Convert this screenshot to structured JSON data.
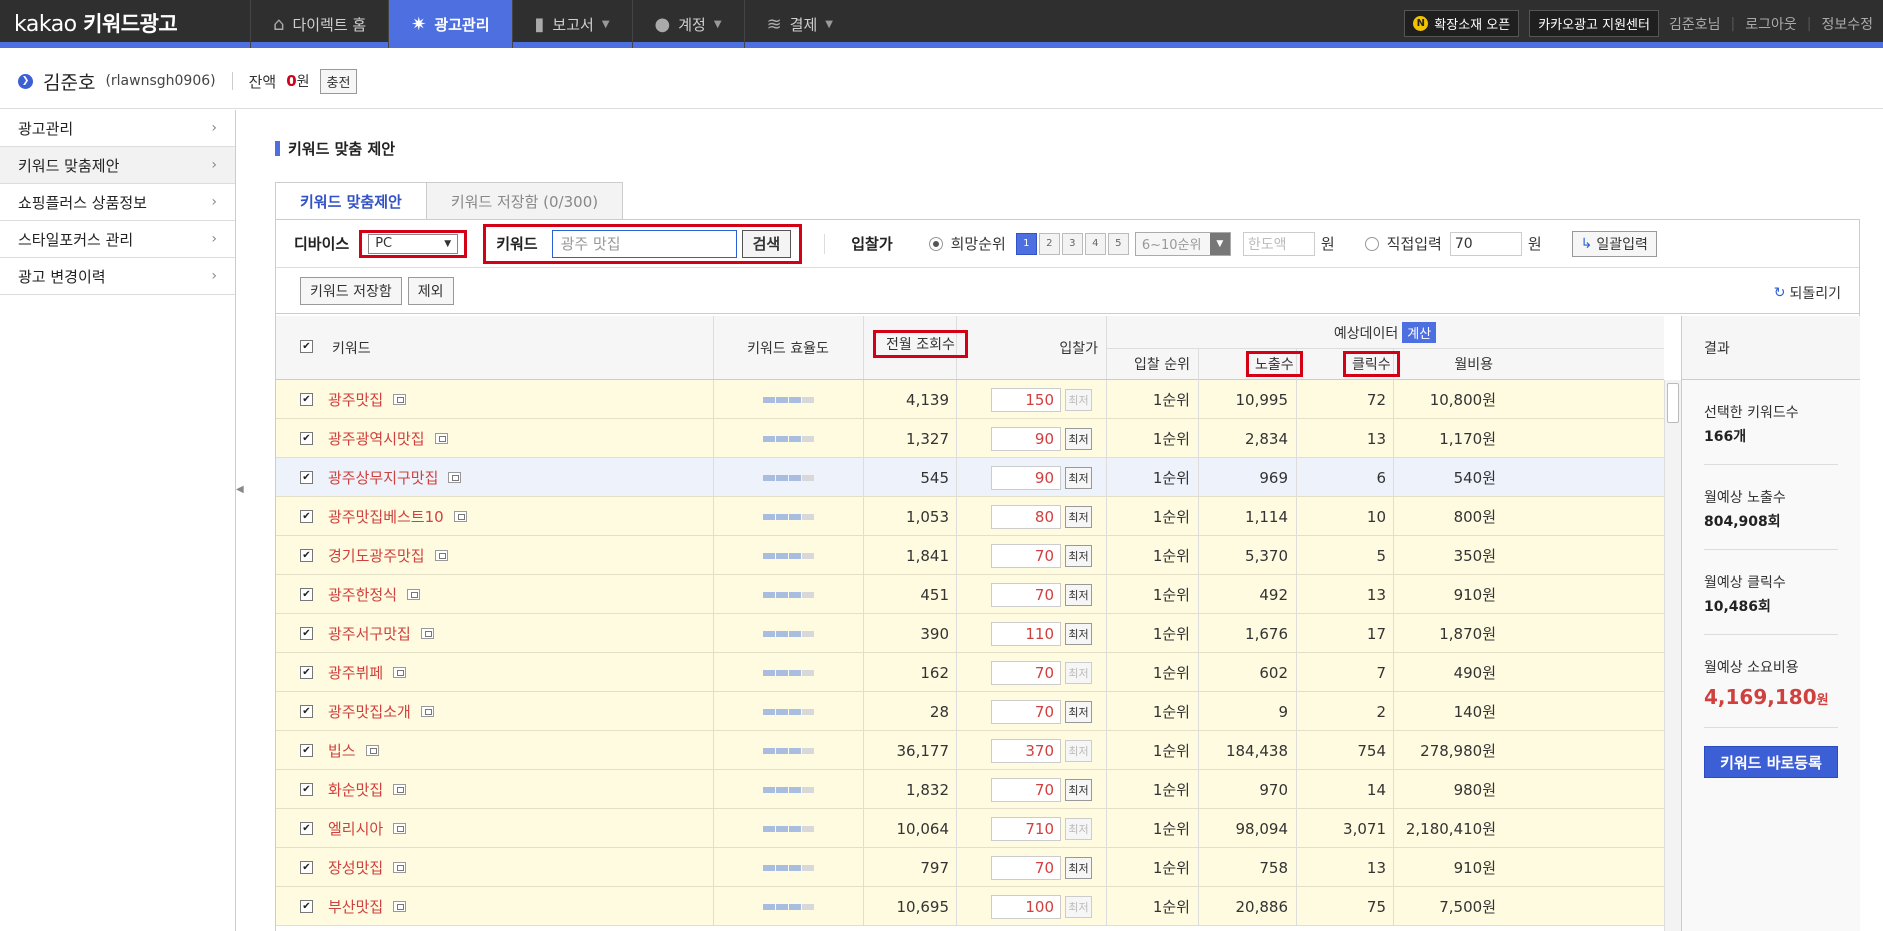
{
  "topbar": {
    "logo_prefix": "kakao",
    "logo_main": "키워드광고",
    "nav": [
      {
        "label": "다이렉트 홈",
        "icon": "home-icon"
      },
      {
        "label": "광고관리",
        "icon": "gear-icon"
      },
      {
        "label": "보고서",
        "icon": "bar-chart-icon"
      },
      {
        "label": "계정",
        "icon": "person-icon"
      },
      {
        "label": "결제",
        "icon": "coins-icon"
      }
    ],
    "promo_badge": "N",
    "promo_label": "확장소재 오픈",
    "support_label": "카카오광고 지원센터",
    "user_label": "김준호님",
    "logout_label": "로그아웃",
    "profile_label": "정보수정"
  },
  "account": {
    "name": "김준호",
    "id": "(rlawnsgh0906)",
    "balance_label": "잔액",
    "balance_value": "0",
    "balance_unit": "원",
    "charge_label": "충전"
  },
  "sidebar": {
    "items": [
      {
        "label": "광고관리"
      },
      {
        "label": "키워드 맞춤제안"
      },
      {
        "label": "쇼핑플러스 상품정보"
      },
      {
        "label": "스타일포커스 관리"
      },
      {
        "label": "광고 변경이력"
      }
    ]
  },
  "page": {
    "title": "키워드 맞춤 제안",
    "tabs": [
      "키워드 맞춤제안",
      "키워드 저장함 (0/300)"
    ]
  },
  "filters": {
    "device_label": "디바이스",
    "device_value": "PC",
    "keyword_label": "키워드",
    "keyword_placeholder": "광주 맛집",
    "search_label": "검색",
    "bid_label": "입찰가",
    "rank_label": "희망순위",
    "rank_buttons": [
      "1",
      "2",
      "3",
      "4",
      "5"
    ],
    "rank_select": "6~10순위",
    "limit_placeholder": "한도액",
    "unit": "원",
    "direct_label": "직접입력",
    "direct_value": "70",
    "batch_label": "일괄입력"
  },
  "actions": {
    "save_label": "키워드 저장함",
    "exclude_label": "제외",
    "restore_label": "되돌리기"
  },
  "table": {
    "headers": {
      "keyword": "키워드",
      "efficiency": "키워드 효율도",
      "monthly_views": "전월 조회수",
      "bid": "입찰가",
      "forecast": "예상데이터",
      "calc": "계산",
      "rank": "입찰 순위",
      "impressions": "노출수",
      "clicks": "클릭수",
      "cost": "월비용"
    },
    "max_label": "최저",
    "rows": [
      {
        "keyword": "광주맛집",
        "eff": 3,
        "views": "4,139",
        "bid": "150",
        "max_disabled": true,
        "rank": "1순위",
        "imp": "10,995",
        "clicks": "72",
        "cost": "10,800원"
      },
      {
        "keyword": "광주광역시맛집",
        "eff": 3,
        "views": "1,327",
        "bid": "90",
        "max_disabled": false,
        "rank": "1순위",
        "imp": "2,834",
        "clicks": "13",
        "cost": "1,170원"
      },
      {
        "keyword": "광주상무지구맛집",
        "eff": 3,
        "views": "545",
        "bid": "90",
        "max_disabled": false,
        "rank": "1순위",
        "imp": "969",
        "clicks": "6",
        "cost": "540원"
      },
      {
        "keyword": "광주맛집베스트10",
        "eff": 3,
        "views": "1,053",
        "bid": "80",
        "max_disabled": false,
        "rank": "1순위",
        "imp": "1,114",
        "clicks": "10",
        "cost": "800원"
      },
      {
        "keyword": "경기도광주맛집",
        "eff": 3,
        "views": "1,841",
        "bid": "70",
        "max_disabled": false,
        "rank": "1순위",
        "imp": "5,370",
        "clicks": "5",
        "cost": "350원"
      },
      {
        "keyword": "광주한정식",
        "eff": 3,
        "views": "451",
        "bid": "70",
        "max_disabled": false,
        "rank": "1순위",
        "imp": "492",
        "clicks": "13",
        "cost": "910원"
      },
      {
        "keyword": "광주서구맛집",
        "eff": 3,
        "views": "390",
        "bid": "110",
        "max_disabled": false,
        "rank": "1순위",
        "imp": "1,676",
        "clicks": "17",
        "cost": "1,870원"
      },
      {
        "keyword": "광주뷔페",
        "eff": 3,
        "views": "162",
        "bid": "70",
        "max_disabled": true,
        "rank": "1순위",
        "imp": "602",
        "clicks": "7",
        "cost": "490원"
      },
      {
        "keyword": "광주맛집소개",
        "eff": 3,
        "views": "28",
        "bid": "70",
        "max_disabled": false,
        "rank": "1순위",
        "imp": "9",
        "clicks": "2",
        "cost": "140원"
      },
      {
        "keyword": "빕스",
        "eff": 3,
        "views": "36,177",
        "bid": "370",
        "max_disabled": true,
        "rank": "1순위",
        "imp": "184,438",
        "clicks": "754",
        "cost": "278,980원"
      },
      {
        "keyword": "화순맛집",
        "eff": 3,
        "views": "1,832",
        "bid": "70",
        "max_disabled": false,
        "rank": "1순위",
        "imp": "970",
        "clicks": "14",
        "cost": "980원"
      },
      {
        "keyword": "엘리시아",
        "eff": 3,
        "views": "10,064",
        "bid": "710",
        "max_disabled": true,
        "rank": "1순위",
        "imp": "98,094",
        "clicks": "3,071",
        "cost": "2,180,410원"
      },
      {
        "keyword": "장성맛집",
        "eff": 3,
        "views": "797",
        "bid": "70",
        "max_disabled": false,
        "rank": "1순위",
        "imp": "758",
        "clicks": "13",
        "cost": "910원"
      },
      {
        "keyword": "부산맛집",
        "eff": 3,
        "views": "10,695",
        "bid": "100",
        "max_disabled": true,
        "rank": "1순위",
        "imp": "20,886",
        "clicks": "75",
        "cost": "7,500원"
      }
    ]
  },
  "result": {
    "title": "결과",
    "selected_label": "선택한 키워드수",
    "selected_value": "166개",
    "imp_label": "월예상 노출수",
    "imp_value": "804,908회",
    "click_label": "월예상 클릭수",
    "click_value": "10,486회",
    "cost_label": "월예상 소요비용",
    "cost_value": "4,169,180",
    "cost_unit": "원",
    "register_label": "키워드 바로등록"
  },
  "colors": {
    "accent": "#4e6fe0",
    "highlight_red": "#d40015",
    "row_bg": "#fffbe0"
  }
}
